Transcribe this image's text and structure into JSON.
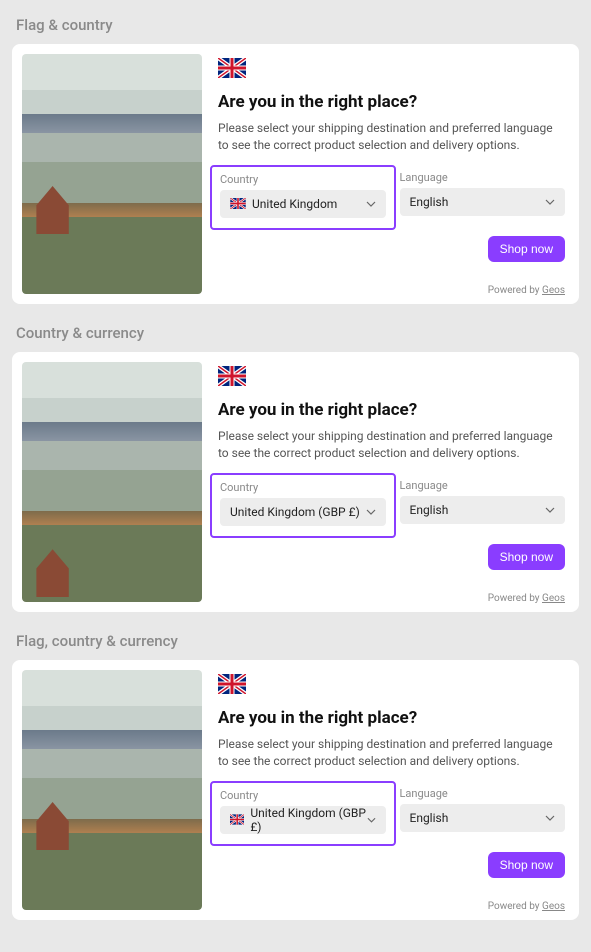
{
  "sections": [
    {
      "title": "Flag & country"
    },
    {
      "title": "Country & currency"
    },
    {
      "title": "Flag, country & currency"
    }
  ],
  "heading": "Are you in the right place?",
  "description": "Please select your shipping destination and preferred language to see the correct product selection and delivery options.",
  "country_label": "Country",
  "language_label": "Language",
  "language_value": "English",
  "shop_button": "Shop now",
  "powered_prefix": "Powered by ",
  "powered_link": "Geos",
  "card0_country": "United Kingdom",
  "card1_country": "United Kingdom (GBP £)",
  "card2_country": "United Kingdom (GBP £)",
  "flag_country": "United Kingdom"
}
